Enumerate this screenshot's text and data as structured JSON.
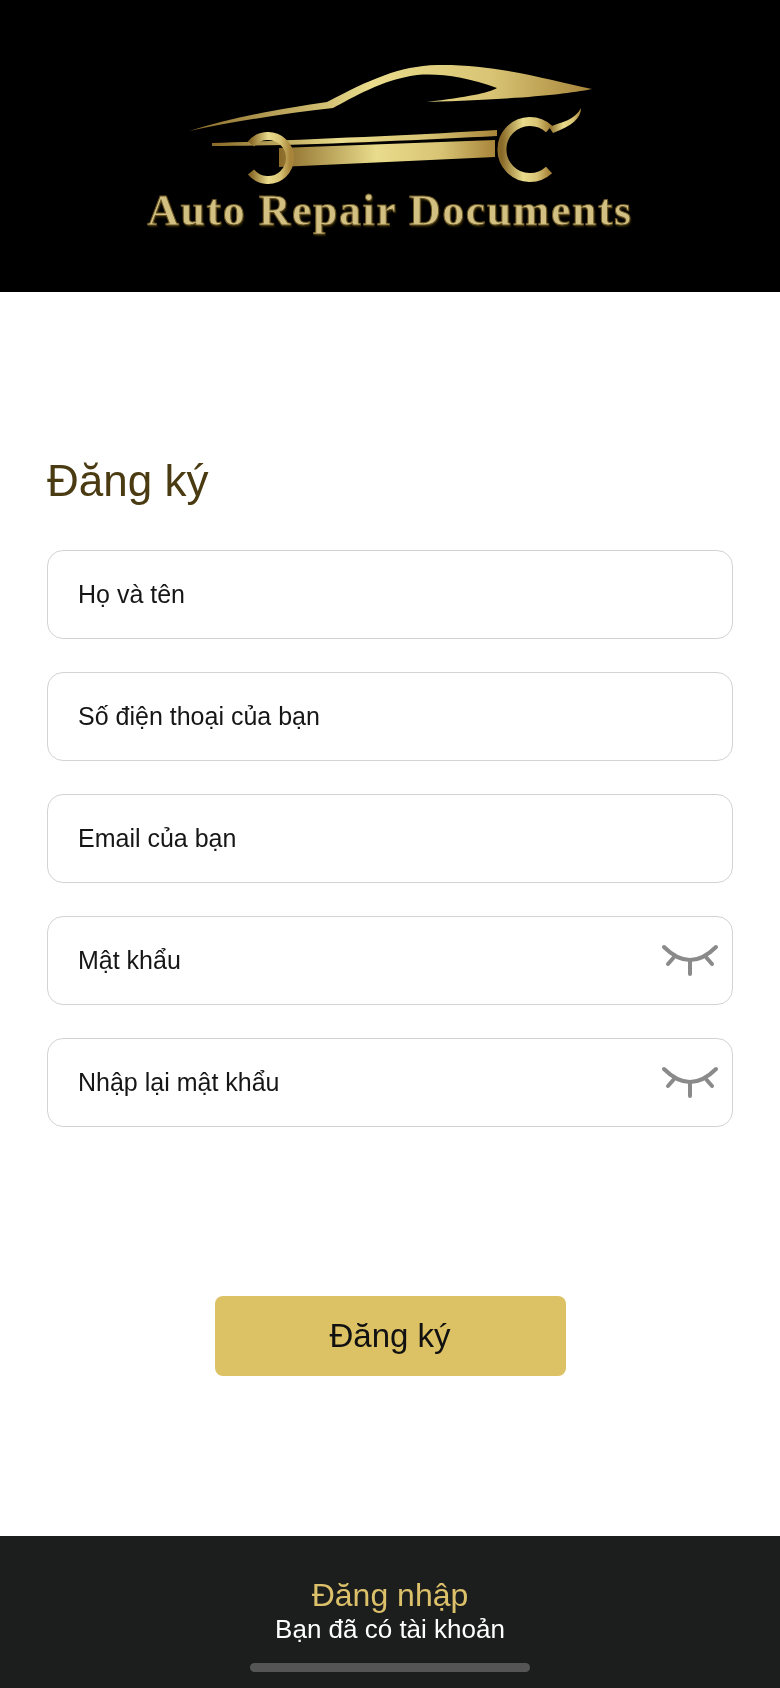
{
  "header": {
    "logo_text": "Auto Repair Documents"
  },
  "form": {
    "title": "Đăng ký",
    "fields": [
      {
        "kind": "text",
        "placeholder": "Họ và tên"
      },
      {
        "kind": "text",
        "placeholder": "Số điện thoại của bạn"
      },
      {
        "kind": "text",
        "placeholder": "Email của bạn"
      },
      {
        "kind": "password",
        "placeholder": "Mật khẩu",
        "revealed": false
      },
      {
        "kind": "password",
        "placeholder": "Nhập lại mật khẩu",
        "revealed": false
      }
    ],
    "submit": "Đăng ký"
  },
  "footer": {
    "link": "Đăng nhập",
    "caption": "Bạn đã có tài khoản"
  }
}
